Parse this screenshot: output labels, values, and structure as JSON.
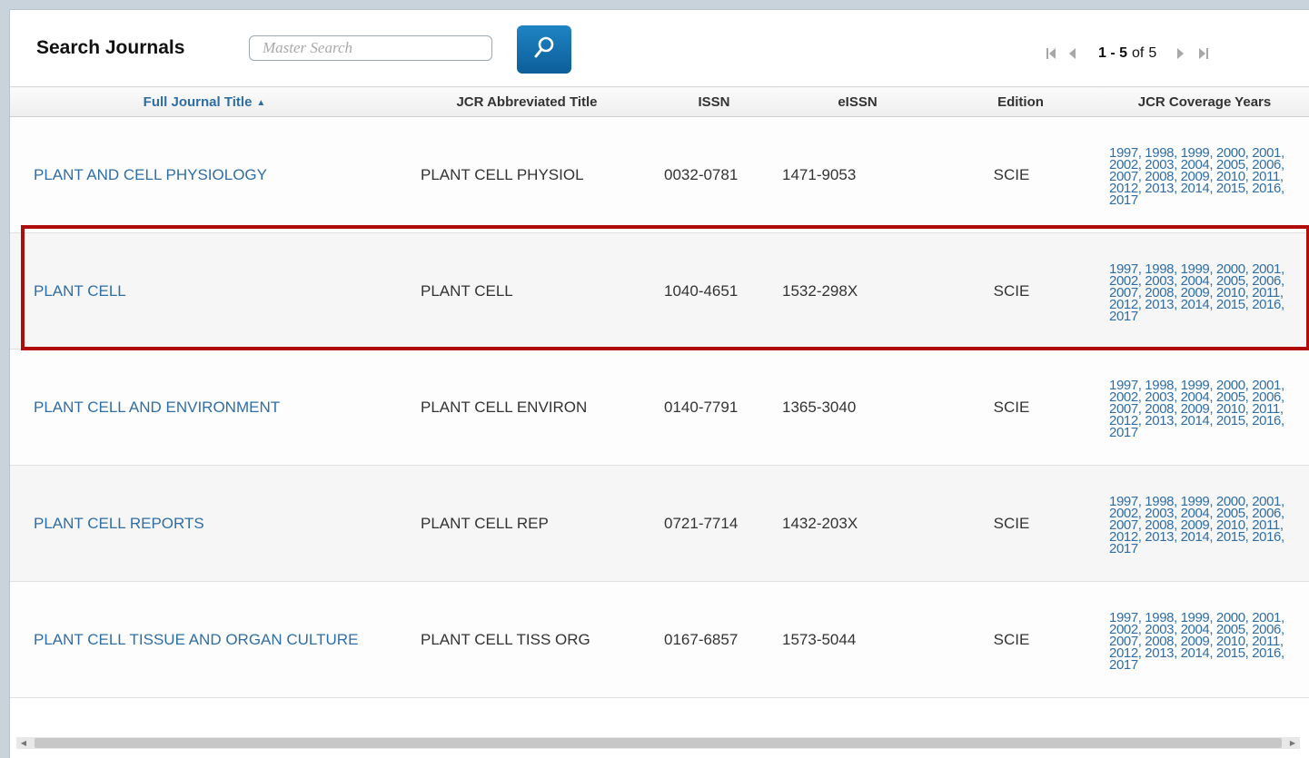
{
  "header": {
    "title": "Search Journals",
    "search_placeholder": "Master Search",
    "pager": {
      "range": "1 - 5",
      "of_label": "of",
      "total": "5"
    }
  },
  "table": {
    "columns": [
      "Full Journal Title",
      "JCR Abbreviated Title",
      "ISSN",
      "eISSN",
      "Edition",
      "JCR Coverage Years"
    ],
    "rows": [
      {
        "full_title": "PLANT AND CELL PHYSIOLOGY",
        "abbr": "PLANT CELL PHYSIOL",
        "issn": "0032-0781",
        "eissn": "1471-9053",
        "edition": "SCIE",
        "years": "1997, 1998, 1999, 2000, 2001, 2002, 2003, 2004, 2005, 2006, 2007, 2008, 2009, 2010, 2011, 2012, 2013, 2014, 2015, 2016, 2017"
      },
      {
        "full_title": "PLANT CELL",
        "abbr": "PLANT CELL",
        "issn": "1040-4651",
        "eissn": "1532-298X",
        "edition": "SCIE",
        "years": "1997, 1998, 1999, 2000, 2001, 2002, 2003, 2004, 2005, 2006, 2007, 2008, 2009, 2010, 2011, 2012, 2013, 2014, 2015, 2016, 2017"
      },
      {
        "full_title": "PLANT CELL AND ENVIRONMENT",
        "abbr": "PLANT CELL ENVIRON",
        "issn": "0140-7791",
        "eissn": "1365-3040",
        "edition": "SCIE",
        "years": "1997, 1998, 1999, 2000, 2001, 2002, 2003, 2004, 2005, 2006, 2007, 2008, 2009, 2010, 2011, 2012, 2013, 2014, 2015, 2016, 2017"
      },
      {
        "full_title": "PLANT CELL REPORTS",
        "abbr": "PLANT CELL REP",
        "issn": "0721-7714",
        "eissn": "1432-203X",
        "edition": "SCIE",
        "years": "1997, 1998, 1999, 2000, 2001, 2002, 2003, 2004, 2005, 2006, 2007, 2008, 2009, 2010, 2011, 2012, 2013, 2014, 2015, 2016, 2017"
      },
      {
        "full_title": "PLANT CELL TISSUE AND ORGAN CULTURE",
        "abbr": "PLANT CELL TISS ORG",
        "issn": "0167-6857",
        "eissn": "1573-5044",
        "edition": "SCIE",
        "years": "1997, 1998, 1999, 2000, 2001, 2002, 2003, 2004, 2005, 2006, 2007, 2008, 2009, 2010, 2011, 2012, 2013, 2014, 2015, 2016, 2017"
      }
    ]
  },
  "colors": {
    "link": "#2f6ea4",
    "search_button": "#1773b3",
    "highlight": "#b10c0c"
  },
  "icons": {
    "search": "magnifier-icon",
    "first_page": "first-page-icon",
    "prev_page": "prev-page-icon",
    "next_page": "next-page-icon",
    "last_page": "last-page-icon"
  }
}
